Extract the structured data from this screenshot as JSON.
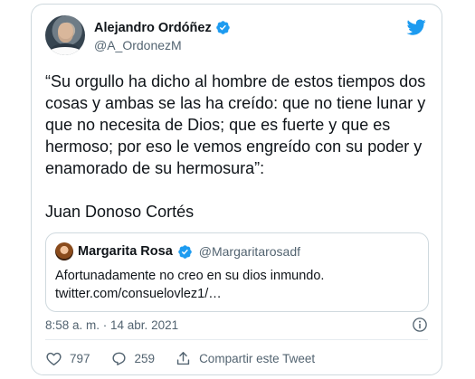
{
  "author": {
    "display_name": "Alejandro Ordóñez",
    "handle": "@A_OrdonezM",
    "verified_icon": "verified-badge-icon"
  },
  "brand": {
    "icon": "twitter-bird-icon",
    "color": "#1d9bf0"
  },
  "tweet": {
    "text": "“Su orgullo ha dicho al hombre de estos tiempos dos cosas y ambas se las ha creído: que no tiene lunar y que no necesita de Dios; que es fuerte y que es hermoso; por eso le vemos engreído con su poder y enamorado de su hermosura”:\n\nJuan Donoso Cortés"
  },
  "quote": {
    "display_name": "Margarita Rosa",
    "handle": "@Margaritarosadf",
    "text": "Afortunadamente no creo en su dios inmundo.\ntwitter.com/consuelovlez1/…"
  },
  "meta": {
    "time": "8:58 a. m. · 14 abr. 2021"
  },
  "actions": {
    "likes": "797",
    "replies": "259",
    "share_label": "Compartir este Tweet"
  },
  "colors": {
    "verified": "#1d9bf0",
    "secondary_text": "#536471",
    "border": "#cfd9de"
  }
}
